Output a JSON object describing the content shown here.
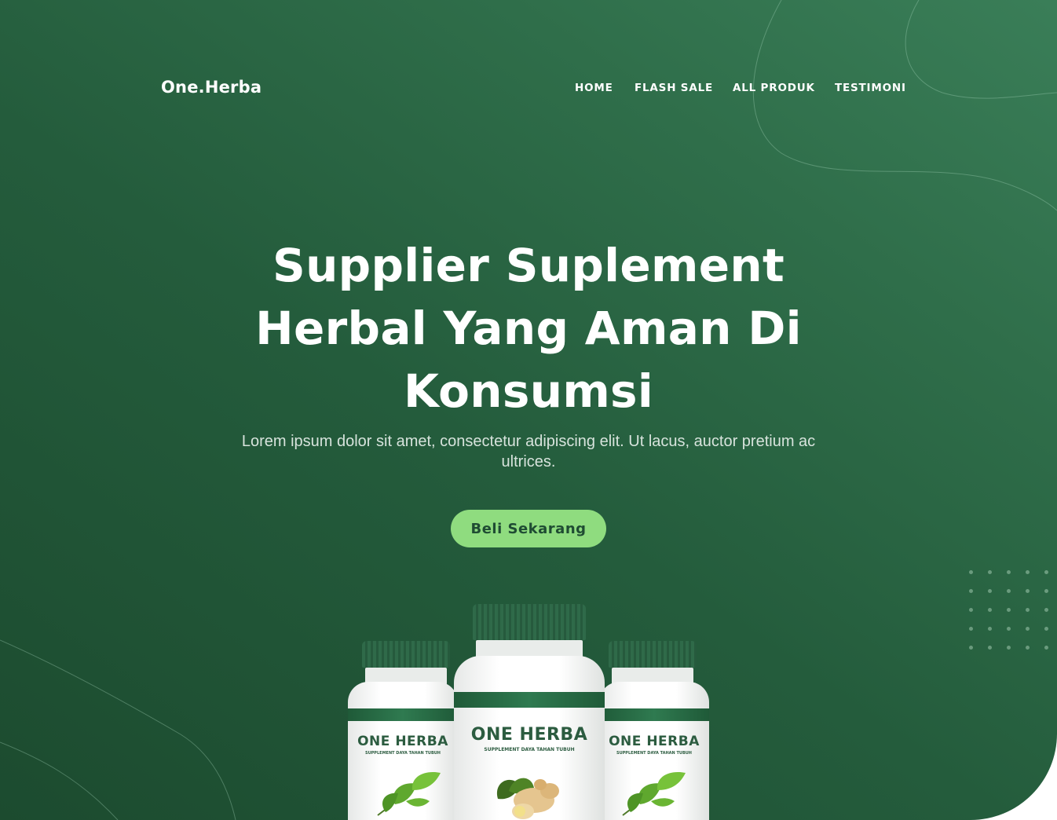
{
  "brand": "One.Herba",
  "nav": [
    {
      "label": "HOME"
    },
    {
      "label": "FLASH SALE"
    },
    {
      "label": "ALL PRODUK"
    },
    {
      "label": "TESTIMONI"
    }
  ],
  "hero": {
    "title_lines": [
      "Supplier Suplement",
      "Herbal Yang Aman Di",
      "Konsumsi"
    ],
    "subtitle_lines": [
      "Lorem ipsum dolor sit amet, consectetur adipiscing elit. Ut lacus, auctor pretium ac",
      "ultrices."
    ],
    "cta_label": "Beli Sekarang"
  },
  "products": [
    {
      "brand_label": "ONE HERBA",
      "tagline": "SUPPLEMENT DAYA TAHAN TUBUH",
      "art": "green-leaves-icon"
    },
    {
      "brand_label": "ONE HERBA",
      "tagline": "SUPPLEMENT DAYA TAHAN TUBUH",
      "art": "ginger-root-icon"
    },
    {
      "brand_label": "ONE HERBA",
      "tagline": "SUPPLEMENT DAYA TAHAN TUBUH",
      "art": "green-leaves-icon"
    }
  ],
  "colors": {
    "hero_dark": "#1c4b2f",
    "hero_light": "#3a7e58",
    "cta_bg": "#8fdc7f",
    "cta_text": "#1f4c33",
    "bottle_green": "#2f6a49"
  }
}
